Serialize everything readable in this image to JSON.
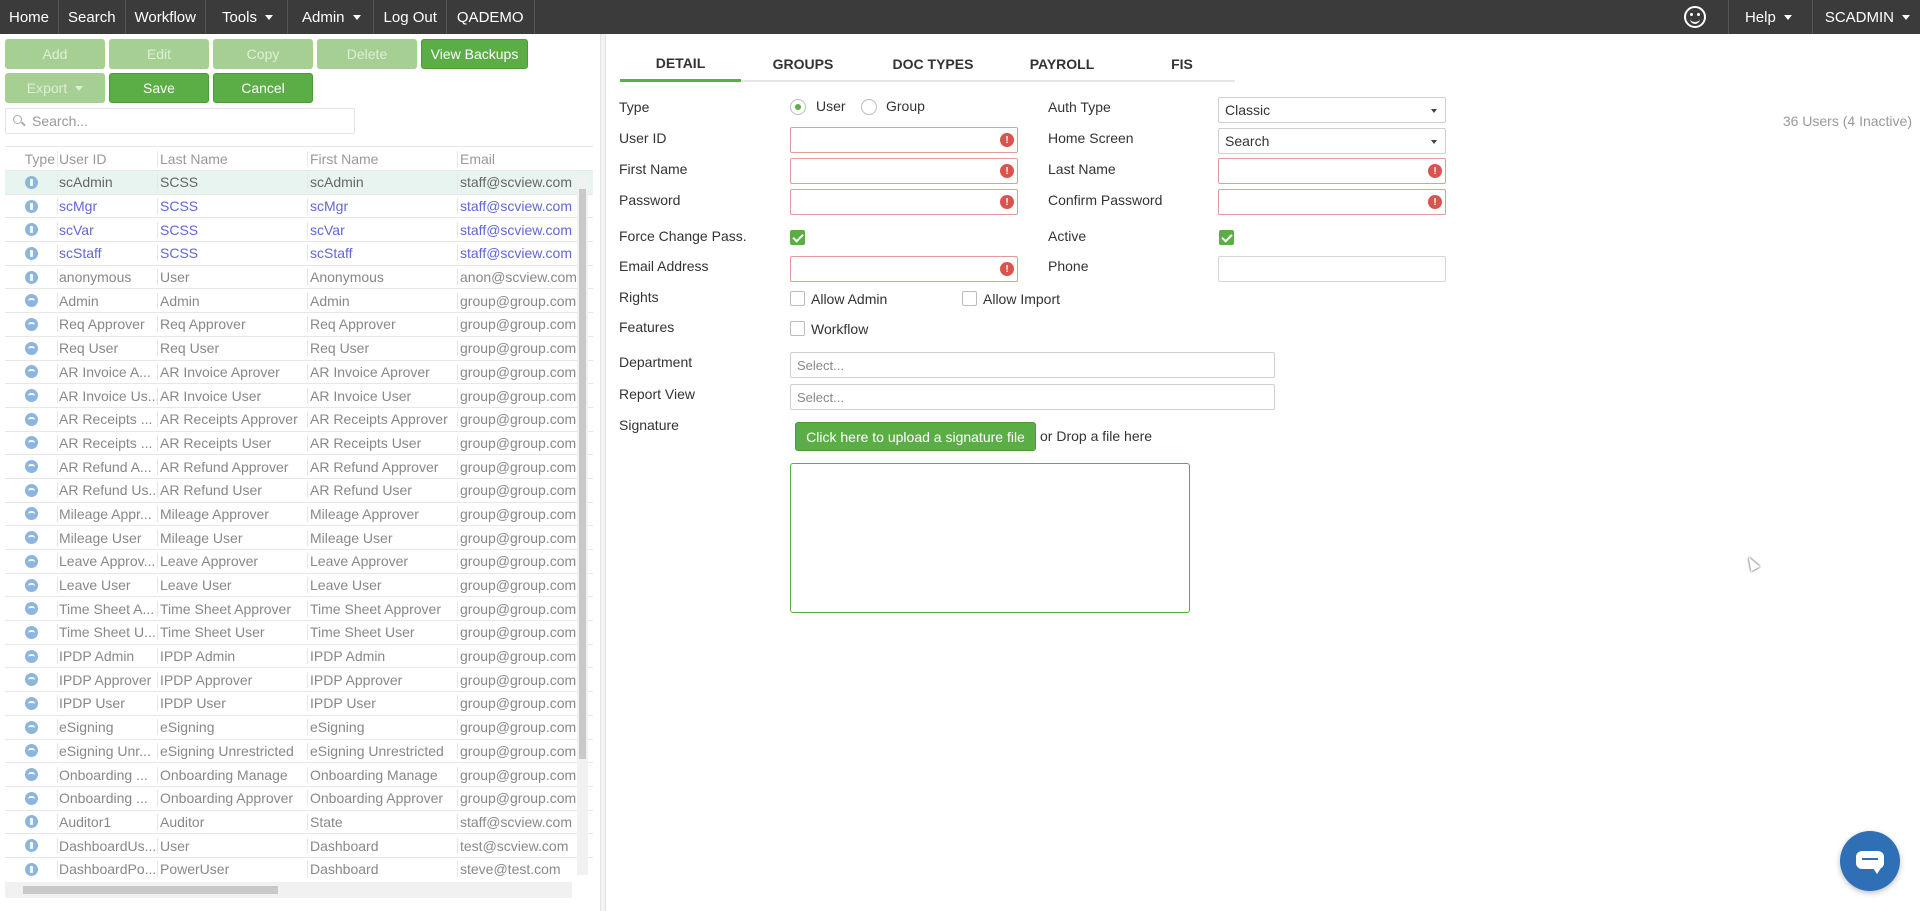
{
  "nav": {
    "items": [
      {
        "label": "Home"
      },
      {
        "label": "Search"
      },
      {
        "label": "Workflow"
      },
      {
        "label": "Tools"
      },
      {
        "label": "Admin"
      },
      {
        "label": "Log Out"
      },
      {
        "label": "QADEMO"
      }
    ],
    "help": "Help",
    "user": "SCADMIN"
  },
  "toolbar": {
    "add": "Add",
    "edit": "Edit",
    "copy": "Copy",
    "delete": "Delete",
    "view_backups": "View Backups",
    "export": "Export",
    "save": "Save",
    "cancel": "Cancel"
  },
  "search": {
    "placeholder": "Search...",
    "count": "36 Users (4 Inactive)"
  },
  "grid": {
    "headers": [
      "Type",
      "User ID",
      "Last Name",
      "First Name",
      "Email"
    ],
    "rows": [
      {
        "type": "user",
        "id": "scAdmin",
        "last": "SCSS",
        "first": "scAdmin",
        "email": "staff@scview.com"
      },
      {
        "type": "user",
        "id": "scMgr",
        "last": "SCSS",
        "first": "scMgr",
        "email": "staff@scview.com"
      },
      {
        "type": "user",
        "id": "scVar",
        "last": "SCSS",
        "first": "scVar",
        "email": "staff@scview.com"
      },
      {
        "type": "user",
        "id": "scStaff",
        "last": "SCSS",
        "first": "scStaff",
        "email": "staff@scview.com"
      },
      {
        "type": "user",
        "id": "anonymous",
        "last": "User",
        "first": "Anonymous",
        "email": "anon@scview.com"
      },
      {
        "type": "group",
        "id": "Admin",
        "last": "Admin",
        "first": "Admin",
        "email": "group@group.com"
      },
      {
        "type": "group",
        "id": "Req Approver",
        "last": "Req Approver",
        "first": "Req Approver",
        "email": "group@group.com"
      },
      {
        "type": "group",
        "id": "Req User",
        "last": "Req User",
        "first": "Req User",
        "email": "group@group.com"
      },
      {
        "type": "group",
        "id": "AR Invoice A...",
        "last": "AR Invoice Aprover",
        "first": "AR Invoice Aprover",
        "email": "group@group.com"
      },
      {
        "type": "group",
        "id": "AR Invoice Us...",
        "last": "AR Invoice User",
        "first": "AR Invoice User",
        "email": "group@group.com"
      },
      {
        "type": "group",
        "id": "AR Receipts ...",
        "last": "AR Receipts Approver",
        "first": "AR Receipts Approver",
        "email": "group@group.com"
      },
      {
        "type": "group",
        "id": "AR Receipts ...",
        "last": "AR Receipts User",
        "first": "AR Receipts User",
        "email": "group@group.com"
      },
      {
        "type": "group",
        "id": "AR Refund A...",
        "last": "AR Refund Approver",
        "first": "AR Refund Approver",
        "email": "group@group.com"
      },
      {
        "type": "group",
        "id": "AR Refund Us...",
        "last": "AR Refund User",
        "first": "AR Refund User",
        "email": "group@group.com"
      },
      {
        "type": "group",
        "id": "Mileage Appr...",
        "last": "Mileage Approver",
        "first": "Mileage Approver",
        "email": "group@group.com"
      },
      {
        "type": "group",
        "id": "Mileage User",
        "last": "Mileage User",
        "first": "Mileage User",
        "email": "group@group.com"
      },
      {
        "type": "group",
        "id": "Leave Approv...",
        "last": "Leave Approver",
        "first": "Leave Approver",
        "email": "group@group.com"
      },
      {
        "type": "group",
        "id": "Leave User",
        "last": "Leave User",
        "first": "Leave User",
        "email": "group@group.com"
      },
      {
        "type": "group",
        "id": "Time Sheet A...",
        "last": "Time Sheet Approver",
        "first": "Time Sheet Approver",
        "email": "group@group.com"
      },
      {
        "type": "group",
        "id": "Time Sheet U...",
        "last": "Time Sheet User",
        "first": "Time Sheet User",
        "email": "group@group.com"
      },
      {
        "type": "group",
        "id": "IPDP Admin",
        "last": "IPDP Admin",
        "first": "IPDP Admin",
        "email": "group@group.com"
      },
      {
        "type": "group",
        "id": "IPDP Approver",
        "last": "IPDP Approver",
        "first": "IPDP Approver",
        "email": "group@group.com"
      },
      {
        "type": "group",
        "id": "IPDP User",
        "last": "IPDP User",
        "first": "IPDP User",
        "email": "group@group.com"
      },
      {
        "type": "group",
        "id": "eSigning",
        "last": "eSigning",
        "first": "eSigning",
        "email": "group@group.com"
      },
      {
        "type": "group",
        "id": "eSigning Unr...",
        "last": "eSigning Unrestricted",
        "first": "eSigning Unrestricted",
        "email": "group@group.com"
      },
      {
        "type": "group",
        "id": "Onboarding ...",
        "last": "Onboarding Manage",
        "first": "Onboarding Manage",
        "email": "group@group.com"
      },
      {
        "type": "group",
        "id": "Onboarding ...",
        "last": "Onboarding Approver",
        "first": "Onboarding Approver",
        "email": "group@group.com"
      },
      {
        "type": "user",
        "id": "Auditor1",
        "last": "Auditor",
        "first": "State",
        "email": "staff@scview.com"
      },
      {
        "type": "user",
        "id": "DashboardUs...",
        "last": "User",
        "first": "Dashboard",
        "email": "test@scview.com"
      },
      {
        "type": "user",
        "id": "DashboardPo...",
        "last": "PowerUser",
        "first": "Dashboard",
        "email": "steve@test.com"
      }
    ]
  },
  "tabs": [
    "DETAIL",
    "GROUPS",
    "DOC TYPES",
    "PAYROLL",
    "FIS"
  ],
  "form": {
    "type_label": "Type",
    "type_user": "User",
    "type_group": "Group",
    "auth_type_label": "Auth Type",
    "auth_type_value": "Classic",
    "user_id_label": "User ID",
    "home_screen_label": "Home Screen",
    "home_screen_value": "Search",
    "first_name_label": "First Name",
    "last_name_label": "Last Name",
    "password_label": "Password",
    "confirm_password_label": "Confirm Password",
    "force_change_label": "Force Change Pass.",
    "active_label": "Active",
    "email_label": "Email Address",
    "phone_label": "Phone",
    "rights_label": "Rights",
    "allow_admin": "Allow Admin",
    "allow_import": "Allow Import",
    "features_label": "Features",
    "workflow": "Workflow",
    "department_label": "Department",
    "department_placeholder": "Select...",
    "report_view_label": "Report View",
    "report_view_placeholder": "Select...",
    "signature_label": "Signature",
    "upload_button": "Click here to upload a signature file",
    "drop_text": "or Drop a file here"
  },
  "colors": {
    "accent": "#5aae45",
    "nav_bg": "#3b3b3b",
    "link": "#6266d4",
    "chat": "#2f6fb5"
  }
}
